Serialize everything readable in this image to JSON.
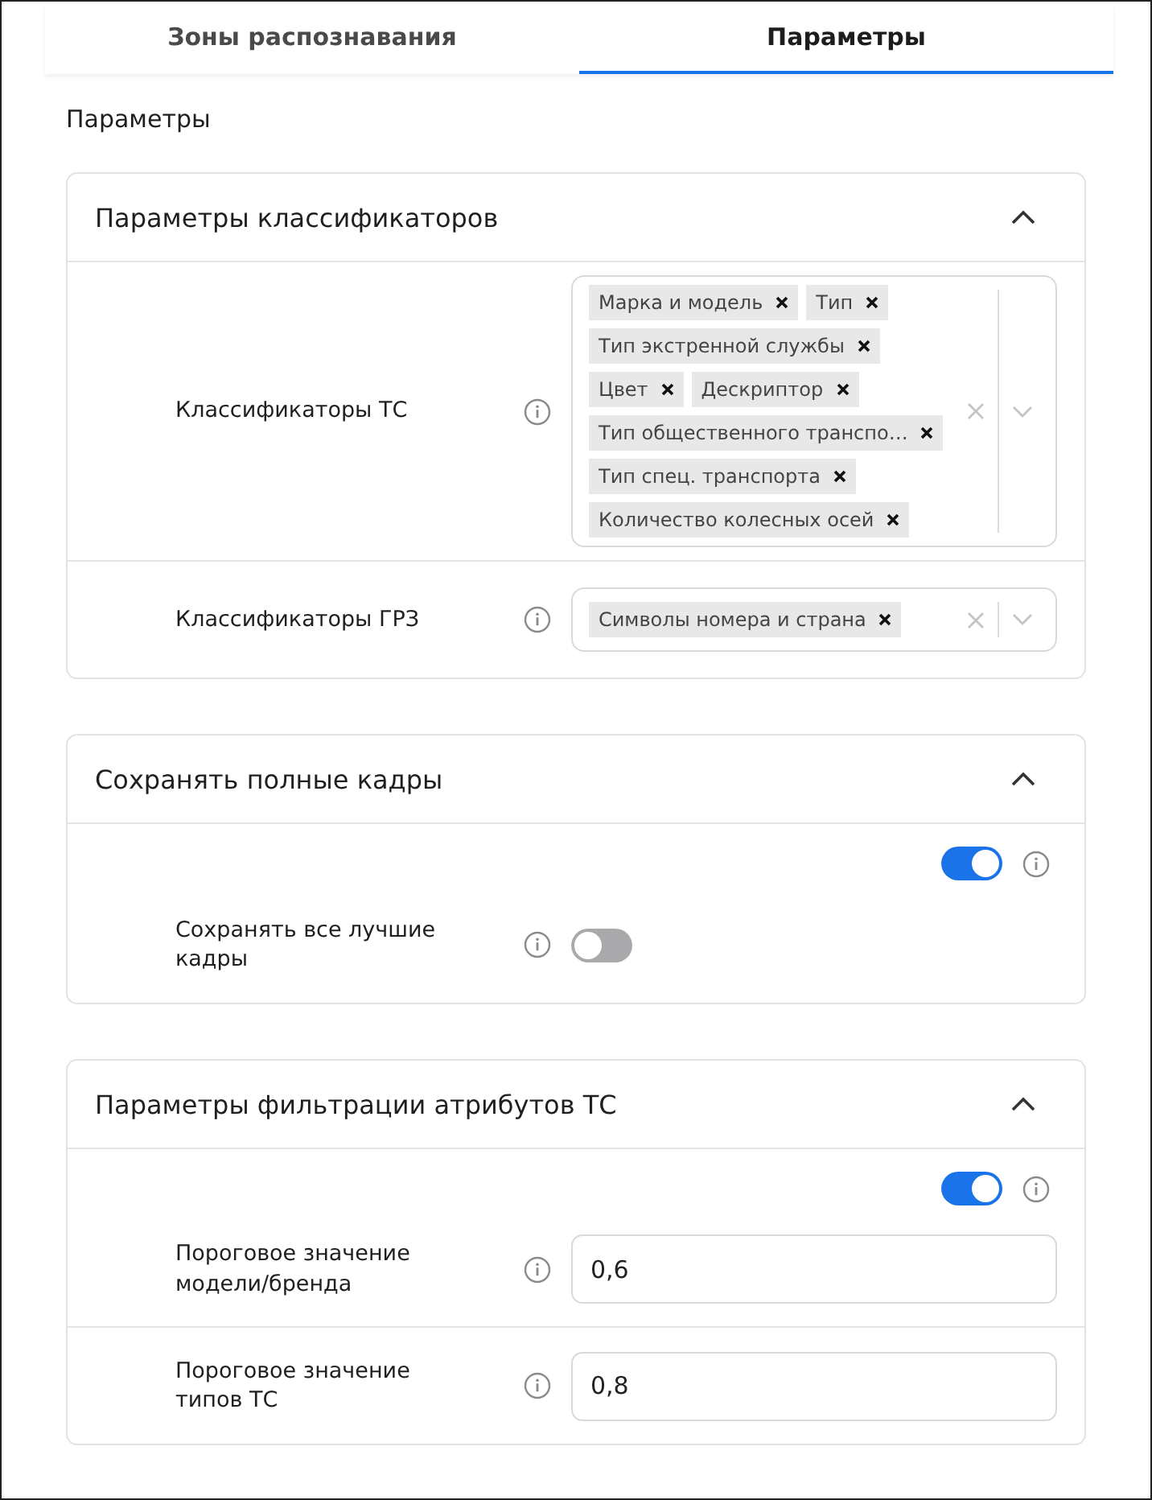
{
  "tabs": [
    {
      "label": "Зоны распознавания",
      "selected": false
    },
    {
      "label": "Параметры",
      "selected": true
    }
  ],
  "heading": "Параметры",
  "sections": [
    {
      "title": "Параметры классификаторов",
      "expanded": true,
      "rows": [
        {
          "kind": "multiselect",
          "label": "Классификаторы ТС",
          "chips": [
            "Марка и модель",
            "Тип",
            "Тип экстренной службы",
            "Цвет",
            "Дескриптор",
            "Тип общественного транспо…",
            "Тип спец. транспорта",
            "Количество колесных осей"
          ]
        },
        {
          "kind": "multiselect",
          "label": "Классификаторы ГРЗ",
          "chips": [
            "Символы номера и страна"
          ]
        }
      ]
    },
    {
      "title": "Сохранять полные кадры",
      "expanded": true,
      "master_on": true,
      "rows": [
        {
          "kind": "toggle",
          "label": "Сохранять все лучшие кадры",
          "on": false
        }
      ]
    },
    {
      "title": "Параметры фильтрации атрибутов ТС",
      "expanded": true,
      "master_on": true,
      "rows": [
        {
          "kind": "input",
          "label": "Пороговое значение модели/бренда",
          "value": "0,6"
        },
        {
          "kind": "input",
          "label": "Пороговое значение типов ТС",
          "value": "0,8"
        }
      ]
    }
  ]
}
